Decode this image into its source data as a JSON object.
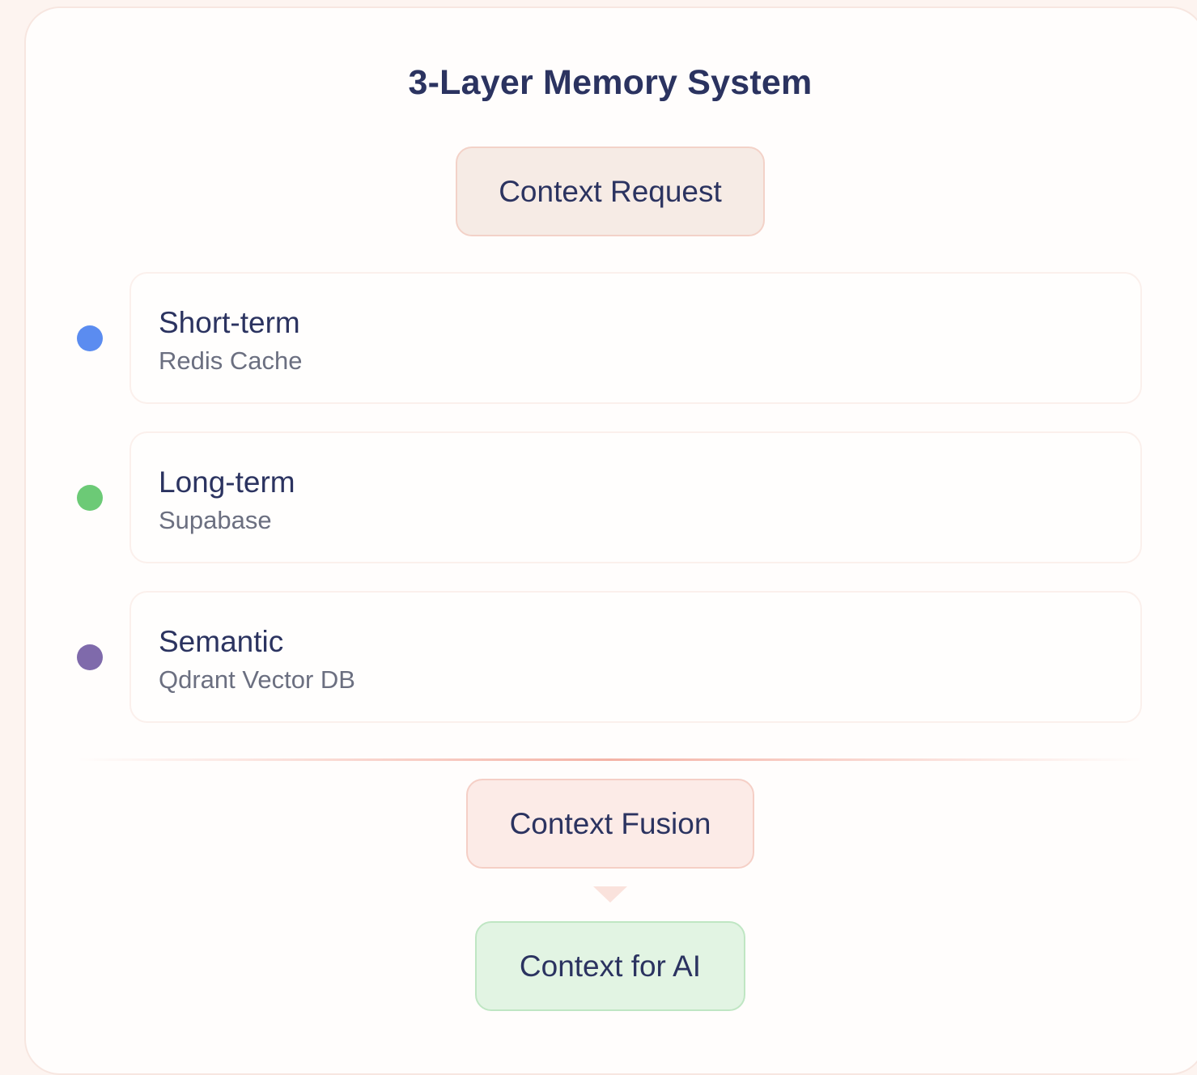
{
  "title": "3-Layer Memory System",
  "request": {
    "label": "Context Request"
  },
  "layers": [
    {
      "name": "Short-term",
      "store": "Redis Cache",
      "color": "#5b8cf0"
    },
    {
      "name": "Long-term",
      "store": "Supabase",
      "color": "#6cca76"
    },
    {
      "name": "Semantic",
      "store": "Qdrant Vector DB",
      "color": "#7f6aab"
    }
  ],
  "fusion": {
    "label": "Context Fusion"
  },
  "output": {
    "label": "Context for AI"
  }
}
